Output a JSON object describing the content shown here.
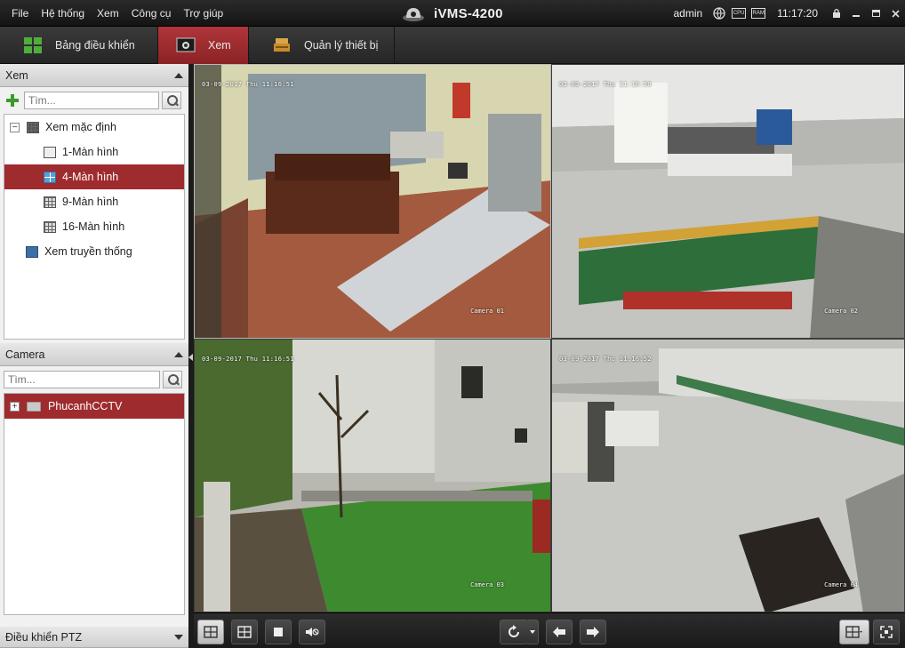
{
  "menu": {
    "items": [
      "File",
      "Hệ thống",
      "Xem",
      "Công cụ",
      "Trợ giúp"
    ]
  },
  "app": {
    "name": "iVMS-4200",
    "user": "admin",
    "clock": "11:17:20",
    "status_icons": [
      "globe-icon",
      "cpu-icon",
      "ram-icon"
    ],
    "cpu_label": "CPU",
    "ram_label": "RAM"
  },
  "tabs": [
    {
      "label": "Bảng điều khiển",
      "icon": "control-panel-icon",
      "active": false
    },
    {
      "label": "Xem",
      "icon": "live-view-icon",
      "active": true
    },
    {
      "label": "Quản lý thiết bị",
      "icon": "device-management-icon",
      "active": false
    }
  ],
  "view_section": {
    "title": "Xem",
    "search_placeholder": "Tìm...",
    "tree": {
      "root_label": "Xem mặc định",
      "items": [
        {
          "label": "1-Màn hình",
          "icon": "single-screen-icon",
          "selected": false
        },
        {
          "label": "4-Màn hình",
          "icon": "quad-screen-icon",
          "selected": true
        },
        {
          "label": "9-Màn hình",
          "icon": "nine-screen-icon",
          "selected": false
        },
        {
          "label": "16-Màn hình",
          "icon": "sixteen-screen-icon",
          "selected": false
        }
      ],
      "custom_label": "Xem truyền thống"
    }
  },
  "camera_section": {
    "title": "Camera",
    "search_placeholder": "Tìm...",
    "group_label": "PhucanhCCTV"
  },
  "ptz_section": {
    "title": "Điều khiển PTZ"
  },
  "cameras": [
    {
      "name": "Camera 01",
      "timestamp": "03-09-2017 Thu 11:16:51",
      "scene": "office"
    },
    {
      "name": "Camera 02",
      "timestamp": "03-09-2017 Thu 11:16:50",
      "scene": "factory"
    },
    {
      "name": "Camera 03",
      "timestamp": "03-09-2017 Thu 11:16:51",
      "scene": "yard"
    },
    {
      "name": "Camera 04",
      "timestamp": "03-09-2017 Thu 11:16:52",
      "scene": "warehouse"
    }
  ],
  "toolbar": {
    "left_buttons": [
      "save-view-icon",
      "layout-icon",
      "stop-all-icon",
      "mute-icon"
    ],
    "center_buttons": [
      "cycle-icon",
      "previous-icon",
      "next-icon"
    ],
    "right_buttons": [
      "window-division-icon",
      "fullscreen-icon"
    ]
  },
  "colors": {
    "accent": "#9e2b2e",
    "tab_active": "#a02d30",
    "titlebar": "#1e1e1e"
  }
}
